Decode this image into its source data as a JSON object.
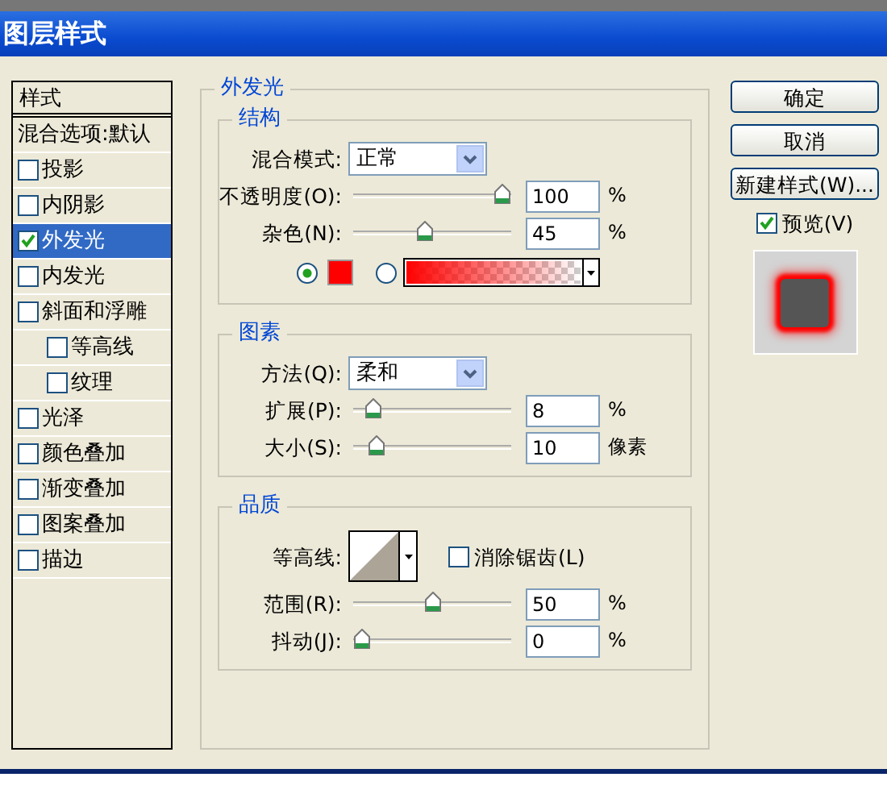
{
  "window": {
    "title": "图层样式"
  },
  "styles_list": {
    "header": "样式",
    "items": [
      {
        "label": "混合选项:默认",
        "kind": "plain",
        "selected": false
      },
      {
        "label": "投影",
        "kind": "check",
        "checked": false,
        "selected": false
      },
      {
        "label": "内阴影",
        "kind": "check",
        "checked": false,
        "selected": false
      },
      {
        "label": "外发光",
        "kind": "check",
        "checked": true,
        "selected": true
      },
      {
        "label": "内发光",
        "kind": "check",
        "checked": false,
        "selected": false
      },
      {
        "label": "斜面和浮雕",
        "kind": "check",
        "checked": false,
        "selected": false,
        "children": [
          {
            "label": "等高线",
            "kind": "check",
            "checked": false,
            "selected": false
          },
          {
            "label": "纹理",
            "kind": "check",
            "checked": false,
            "selected": false
          }
        ]
      },
      {
        "label": "光泽",
        "kind": "check",
        "checked": false,
        "selected": false
      },
      {
        "label": "颜色叠加",
        "kind": "check",
        "checked": false,
        "selected": false
      },
      {
        "label": "渐变叠加",
        "kind": "check",
        "checked": false,
        "selected": false
      },
      {
        "label": "图案叠加",
        "kind": "check",
        "checked": false,
        "selected": false
      },
      {
        "label": "描边",
        "kind": "check",
        "checked": false,
        "selected": false
      }
    ]
  },
  "panel": {
    "title": "外发光",
    "groups": [
      {
        "title": "结构",
        "rows": [
          {
            "kind": "select",
            "label": "混合模式:",
            "value": "正常"
          },
          {
            "kind": "slider",
            "label": "不透明度(O):",
            "level": 1,
            "value": "100",
            "unit": "%"
          },
          {
            "kind": "slider",
            "label": "杂色(N):",
            "level": 0.45,
            "value": "45",
            "unit": "%"
          },
          {
            "kind": "fill",
            "color": "#ff0000",
            "options": [
              {
                "kind": "solid",
                "selected": true
              },
              {
                "kind": "gradient",
                "selected": false
              }
            ]
          }
        ]
      },
      {
        "title": "图素",
        "rows": [
          {
            "kind": "select",
            "label": "方法(Q):",
            "value": "柔和"
          },
          {
            "kind": "slider",
            "label": "扩展(P):",
            "level": 0.08,
            "value": "8",
            "unit": "%"
          },
          {
            "kind": "slider",
            "label": "大小(S):",
            "level": 0.1,
            "value": "10",
            "unit": "像素"
          }
        ]
      },
      {
        "title": "品质",
        "rows": [
          {
            "kind": "contour",
            "label": "等高线:",
            "checkbox": {
              "label": "消除锯齿(L)",
              "checked": false
            }
          },
          {
            "kind": "slider",
            "label": "范围(R):",
            "level": 0.5,
            "value": "50",
            "unit": "%"
          },
          {
            "kind": "slider",
            "label": "抖动(J):",
            "level": 0,
            "value": "0",
            "unit": "%"
          }
        ]
      }
    ]
  },
  "buttons": [
    "确定",
    "取消",
    "新建样式(W)..."
  ],
  "preview": {
    "label": "预览(V)",
    "checked": true
  }
}
